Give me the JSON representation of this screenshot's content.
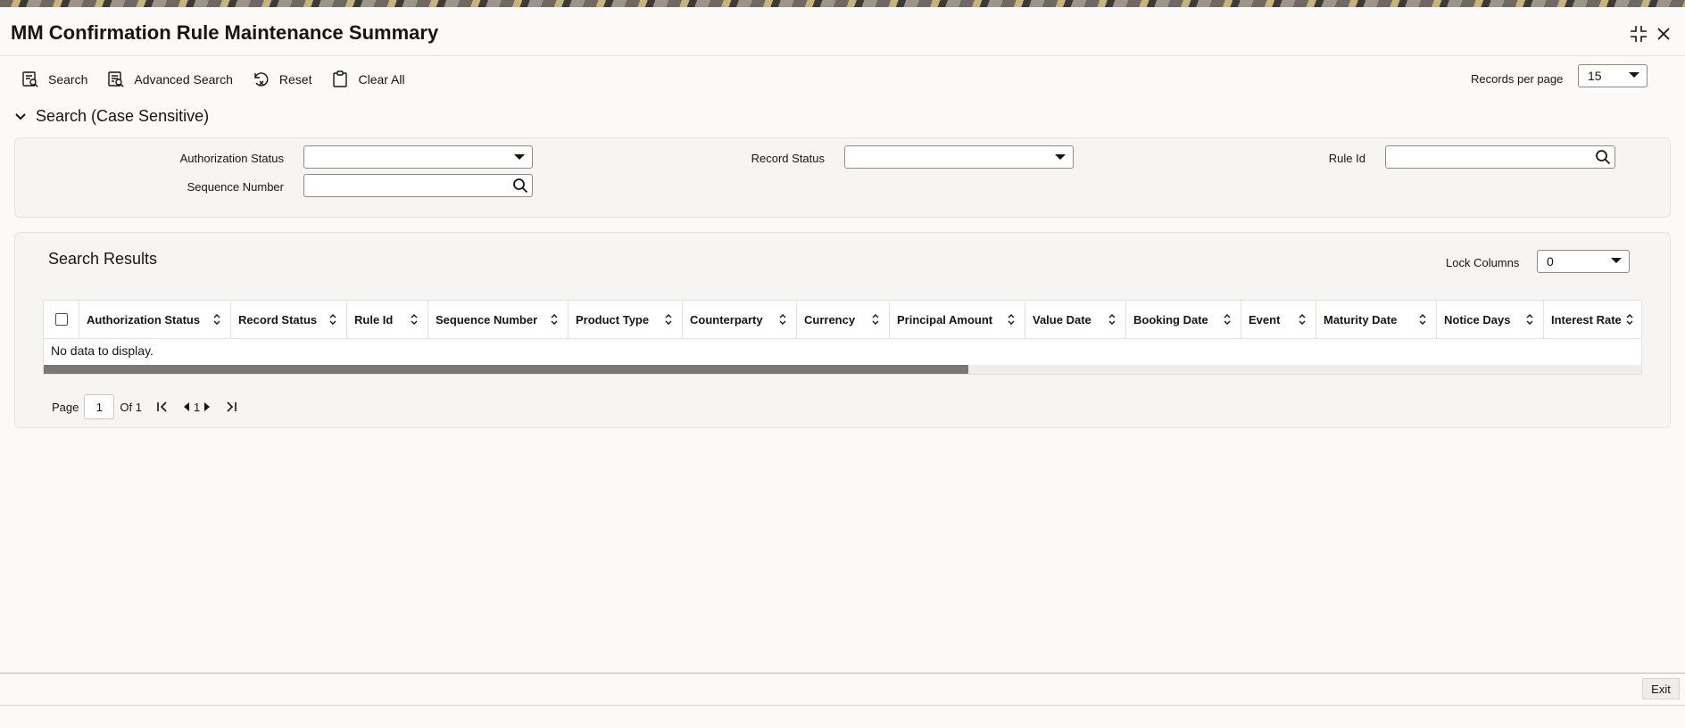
{
  "window": {
    "title": "MM Confirmation Rule Maintenance Summary"
  },
  "toolbar": {
    "search": "Search",
    "advanced_search": "Advanced Search",
    "reset": "Reset",
    "clear_all": "Clear All"
  },
  "records_per_page": {
    "label": "Records per page",
    "value": "15"
  },
  "search_section": {
    "title": "Search (Case Sensitive)",
    "authorization_status": {
      "label": "Authorization Status",
      "value": ""
    },
    "record_status": {
      "label": "Record Status",
      "value": ""
    },
    "rule_id": {
      "label": "Rule Id",
      "value": ""
    },
    "sequence_number": {
      "label": "Sequence Number",
      "value": ""
    }
  },
  "results": {
    "title": "Search Results",
    "lock_columns": {
      "label": "Lock Columns",
      "value": "0"
    },
    "columns": [
      "Authorization Status",
      "Record Status",
      "Rule Id",
      "Sequence Number",
      "Product Type",
      "Counterparty",
      "Currency",
      "Principal Amount",
      "Value Date",
      "Booking Date",
      "Event",
      "Maturity Date",
      "Notice Days",
      "Interest Rate"
    ],
    "empty_message": "No data to display."
  },
  "pagination": {
    "page_label": "Page",
    "page_value": "1",
    "of_label": "Of 1",
    "current": "1"
  },
  "footer": {
    "exit": "Exit"
  }
}
